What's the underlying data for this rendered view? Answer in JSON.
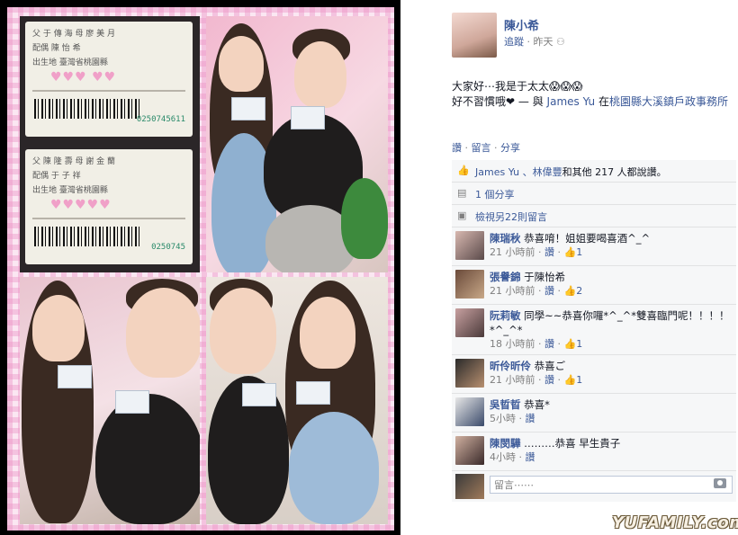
{
  "post": {
    "author": "陳小希",
    "meta_follow": "追蹤",
    "meta_time": "昨天",
    "status_line1": "大家好⋯我是于太太😱😱😱",
    "status_line2_prefix": "好不習慣哦❤",
    "status_with": "— 與",
    "status_tagged": "James Yu",
    "status_at": "在",
    "status_place": "桃園縣大溪鎮戶政事務所"
  },
  "actions": {
    "like": "讚",
    "comment": "留言",
    "share": "分享",
    "sep": "·"
  },
  "likes": {
    "names": "James Yu 、林偉豐",
    "rest": "和其他 217 人都說讚。"
  },
  "shares": {
    "text": "1 個分享"
  },
  "more_comments": {
    "text": "檢視另22則留言"
  },
  "comments": [
    {
      "name": "陳瑞秋",
      "text": "恭喜唷！姐姐要喝喜酒^_^",
      "time": "21 小時前",
      "like": "讚",
      "count": "1"
    },
    {
      "name": "張譽錦",
      "text": "于陳怡希",
      "time": "21 小時前",
      "like": "讚",
      "count": "2"
    },
    {
      "name": "阮莉敏",
      "text": "同學~~恭喜你囉*^_^*雙喜臨門呢！！！！*^_^*",
      "time": "18 小時前",
      "like": "讚",
      "count": "1"
    },
    {
      "name": "昕伶昕伶",
      "text": "恭喜ご",
      "time": "21 小時前",
      "like": "讚",
      "count": "1"
    },
    {
      "name": "吳晢晢",
      "text": "恭喜*",
      "time": "5小時",
      "like": "讚",
      "count": ""
    },
    {
      "name": "陳閔驊",
      "text": "………恭喜 早生貴子",
      "time": "4小時",
      "like": "讚",
      "count": ""
    }
  ],
  "reply": {
    "placeholder": "留言⋯⋯"
  },
  "id_card_1": {
    "line1": "父 于 傳 海 母 廖 美 月",
    "spouse": "配偶 陳 怡 希",
    "birth": "出生地 臺灣省桃園縣",
    "number": "0250745611"
  },
  "id_card_2": {
    "line1": "父 陳 隆 壽 母 謝 金 蘭",
    "spouse": "配偶 于 子 祥",
    "birth": "出生地 臺灣省桃園縣",
    "number": "0250745"
  },
  "watermark": "YUFAMILY.com.cn",
  "colors": {
    "link": "#3b5998",
    "frame_pink": "#f4a8d0",
    "meta_gray": "#7f7f7f"
  }
}
